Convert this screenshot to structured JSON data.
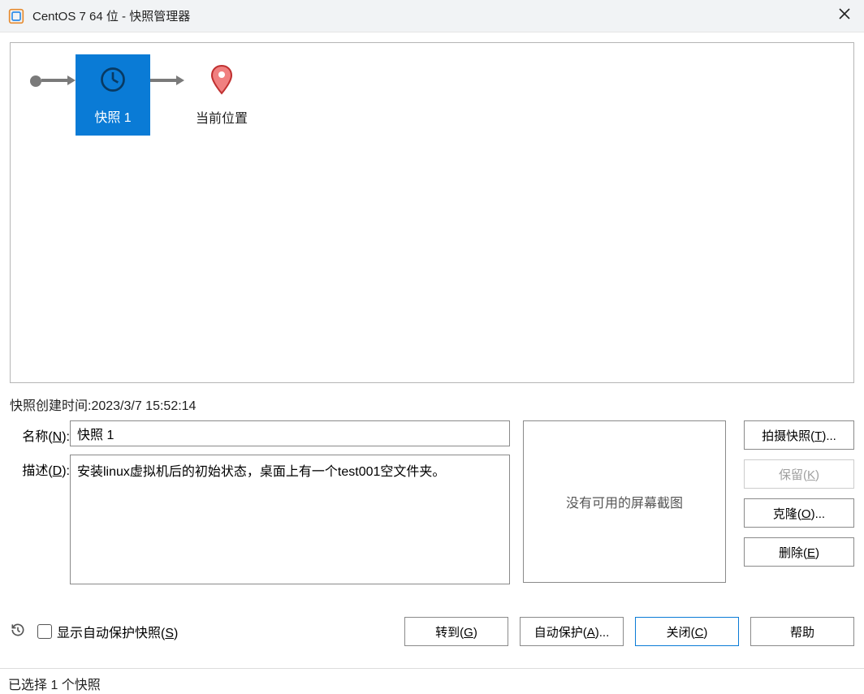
{
  "window": {
    "title": "CentOS 7 64 位 - 快照管理器"
  },
  "tree": {
    "snapshot_node_label": "快照 1",
    "current_location_label": "当前位置"
  },
  "info": {
    "creation_time_label": "快照创建时间:2023/3/7 15:52:14",
    "name_label_pre": "名称(",
    "name_label_key": "N",
    "name_label_post": "):",
    "name_value": "快照 1",
    "desc_label_pre": "描述(",
    "desc_label_key": "D",
    "desc_label_post": "):",
    "desc_value": "安装linux虚拟机后的初始状态，桌面上有一个test001空文件夹。",
    "thumb_placeholder": "没有可用的屏幕截图"
  },
  "side_buttons": {
    "take": "拍摄快照(T)...",
    "keep": "保留(K)",
    "clone": "克隆(O)...",
    "delete": "删除(E)"
  },
  "bottom": {
    "checkbox_label_pre": "显示自动保护快照(",
    "checkbox_label_key": "S",
    "checkbox_label_post": ")",
    "goto": "转到(G)",
    "auto_protect": "自动保护(A)...",
    "close": "关闭(C)",
    "help": "帮助"
  },
  "status": {
    "text": "已选择 1 个快照"
  }
}
